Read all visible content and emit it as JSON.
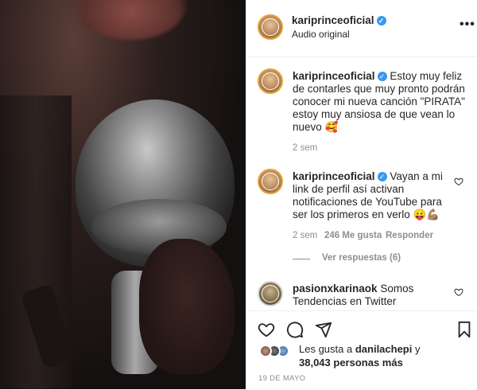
{
  "post": {
    "author": "kariprinceoficial",
    "audio_label": "Audio original",
    "more_label": "•••",
    "caption": "Estoy muy feliz de contarles que muy pronto podrán conocer mi nueva canción \"PIRATA\" estoy muy ansiosa de que vean lo nuevo 🥰",
    "caption_time": "2 sem"
  },
  "comments": [
    {
      "user": "kariprinceoficial",
      "text": "Vayan a mi link de perfil así activan notificaciones de YouTube para ser los primeros en verlo 😛💪🏽",
      "time": "2 sem",
      "likes": "246 Me gusta",
      "reply_label": "Responder",
      "view_replies": "Ver respuestas (6)"
    },
    {
      "user": "pasionxkarinaok",
      "text": "Somos Tendencias en Twitter"
    }
  ],
  "likes_summary": {
    "prefix": "Les gusta a",
    "user": "danilachepi",
    "suffix": "y",
    "count_text": "38,043 personas más"
  },
  "date": "19 DE MAYO",
  "colors": {
    "verified": "#3897f0",
    "muted": "#8e8e8e",
    "text": "#262626"
  }
}
